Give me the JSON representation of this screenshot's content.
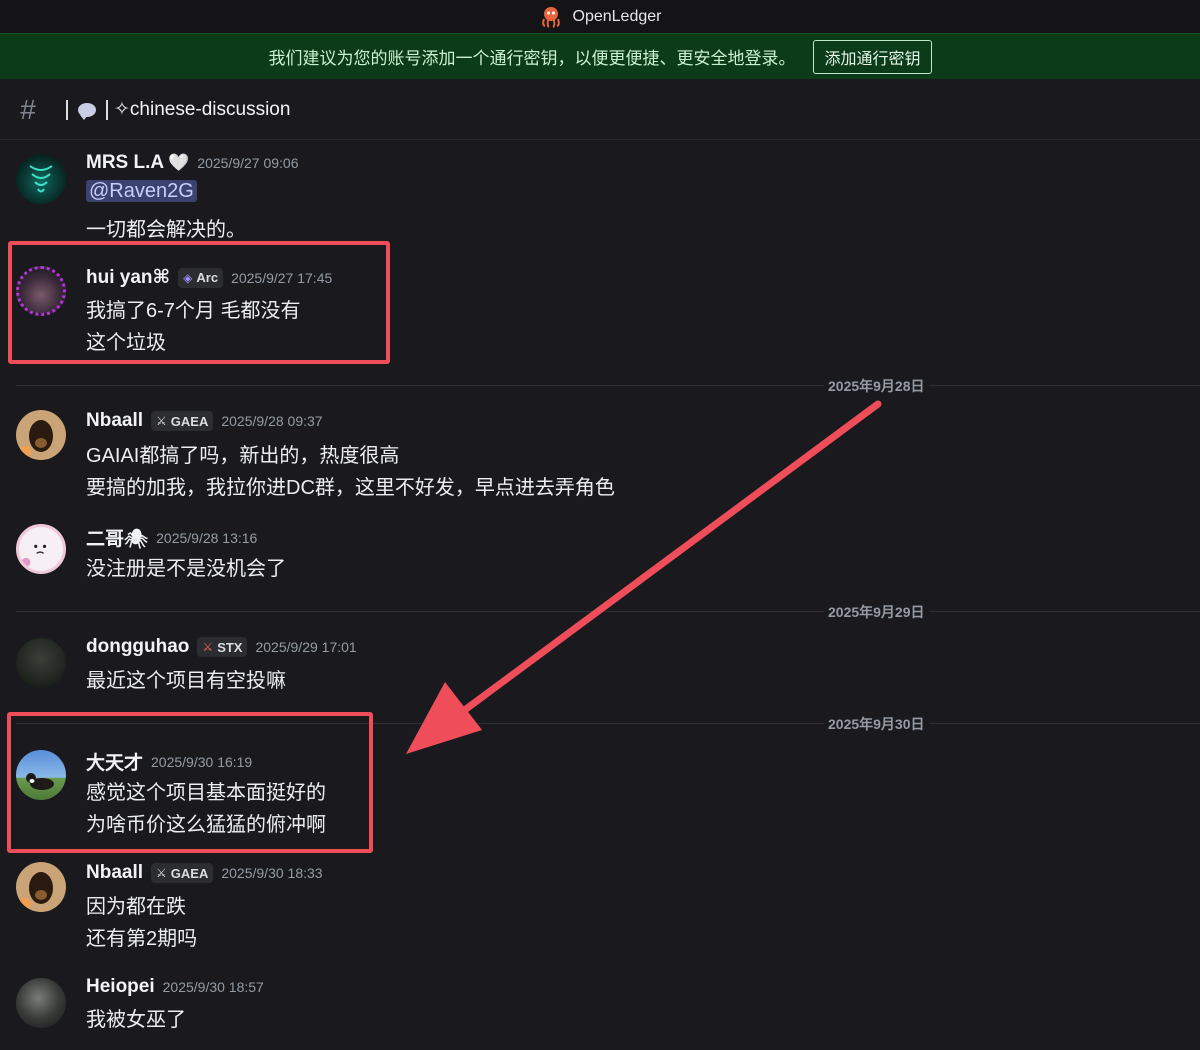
{
  "window": {
    "app_title": "OpenLedger"
  },
  "banner": {
    "text": "我们建议为您的账号添加一个通行密钥，以便更便捷、更安全地登录。",
    "button_label": "添加通行密钥"
  },
  "channel": {
    "name": "✧chinese-discussion",
    "hash_symbol": "#"
  },
  "dates": [
    "2025年9月28日",
    "2025年9月29日",
    "2025年9月30日"
  ],
  "messages": [
    {
      "username": "MRS L.A",
      "username_suffix": "🤍",
      "timestamp": "2025/9/27 09:06",
      "mention": "@Raven2G",
      "lines": [
        "一切都会解决的。"
      ]
    },
    {
      "username": "hui yan⌘",
      "tag": "Arc",
      "timestamp": "2025/9/27 17:45",
      "lines": [
        "我搞了6-7个月  毛都没有",
        "这个垃圾"
      ]
    },
    {
      "username": "Nbaall",
      "tag": "GAEA",
      "timestamp": "2025/9/28 09:37",
      "lines": [
        "GAIAI都搞了吗，新出的，热度很高",
        "要搞的加我，我拉你进DC群，这里不好发，早点进去弄角色"
      ]
    },
    {
      "username": "二哥🕷",
      "timestamp": "2025/9/28 13:16",
      "lines": [
        "没注册是不是没机会了"
      ]
    },
    {
      "username": "dongguhao",
      "tag": "STX",
      "timestamp": "2025/9/29 17:01",
      "lines": [
        "最近这个项目有空投嘛"
      ]
    },
    {
      "username": "大天才",
      "timestamp": "2025/9/30 16:19",
      "lines": [
        "感觉这个项目基本面挺好的",
        "为啥币价这么猛猛的俯冲啊"
      ]
    },
    {
      "username": "Nbaall",
      "tag": "GAEA",
      "timestamp": "2025/9/30 18:33",
      "lines": [
        "因为都在跌",
        "还有第2期吗"
      ]
    },
    {
      "username": "Heiopei",
      "timestamp": "2025/9/30 18:57",
      "lines": [
        "我被女巫了"
      ]
    }
  ],
  "colors": {
    "annotation": "#ef4d5a",
    "banner_bg": "#0b3b18",
    "background": "#1a1a1e"
  },
  "icons": {
    "logo": "octopus-logo-icon",
    "tag_icon": "crossed-swords-icon"
  }
}
